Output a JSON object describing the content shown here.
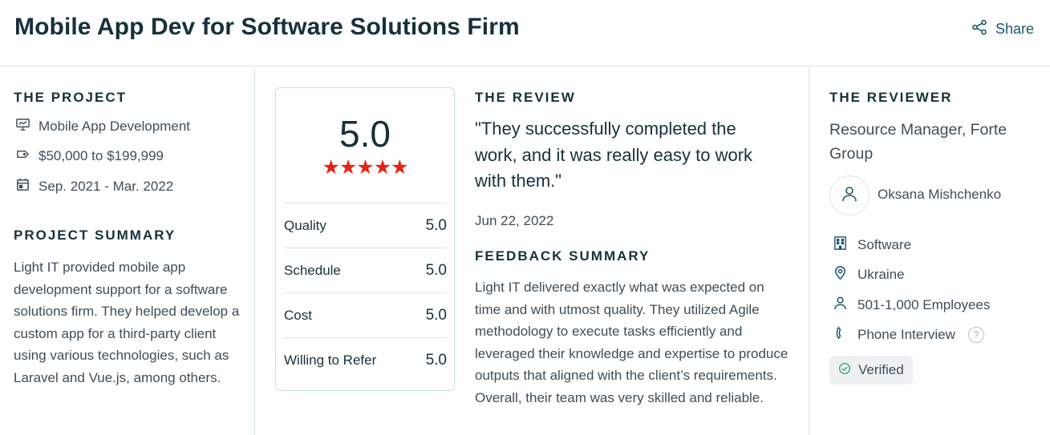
{
  "header": {
    "title": "Mobile App Dev for Software Solutions Firm",
    "share_label": "Share"
  },
  "project": {
    "heading": "THE PROJECT",
    "service": "Mobile App Development",
    "budget": "$50,000 to $199,999",
    "dates": "Sep. 2021 - Mar. 2022",
    "summary_heading": "PROJECT SUMMARY",
    "summary": "Light IT provided mobile app development support for a software solutions firm. They helped develop a custom app for a third-party client using various technologies, such as Laravel and Vue.js, among others."
  },
  "rating": {
    "overall": "5.0",
    "stars": "★★★★★",
    "star_count": 5,
    "star_color": "#e62415",
    "scores": [
      {
        "label": "Quality",
        "value": "5.0"
      },
      {
        "label": "Schedule",
        "value": "5.0"
      },
      {
        "label": "Cost",
        "value": "5.0"
      },
      {
        "label": "Willing to Refer",
        "value": "5.0"
      }
    ]
  },
  "review": {
    "heading": "THE REVIEW",
    "quote": "\"They successfully completed the work, and it was really easy to work with them.\"",
    "date": "Jun 22, 2022",
    "feedback_heading": "FEEDBACK SUMMARY",
    "feedback": "Light IT delivered exactly what was expected on time and with utmost quality. They utilized Agile methodology to execute tasks efficiently and leveraged their knowledge and expertise to produce outputs that aligned with the client’s requirements. Overall, their team was very skilled and reliable."
  },
  "reviewer": {
    "heading": "THE REVIEWER",
    "role": "Resource Manager, Forte Group",
    "name": "Oksana Mishchenko",
    "industry": "Software",
    "location": "Ukraine",
    "size": "501-1,000 Employees",
    "interview": "Phone Interview",
    "help_glyph": "?",
    "verified_label": "Verified"
  },
  "colors": {
    "title": "#17313b",
    "accent": "#17576d",
    "star": "#e62415",
    "divider": "#d6e4ea"
  },
  "icons": {
    "share": "share-icon",
    "service": "presentation-icon",
    "budget": "price-tag-icon",
    "dates": "calendar-icon",
    "avatar": "user-icon",
    "industry": "building-icon",
    "location": "location-pin-icon",
    "size": "person-icon",
    "interview": "phone-icon",
    "help": "help-icon",
    "verified": "check-circle-icon"
  }
}
